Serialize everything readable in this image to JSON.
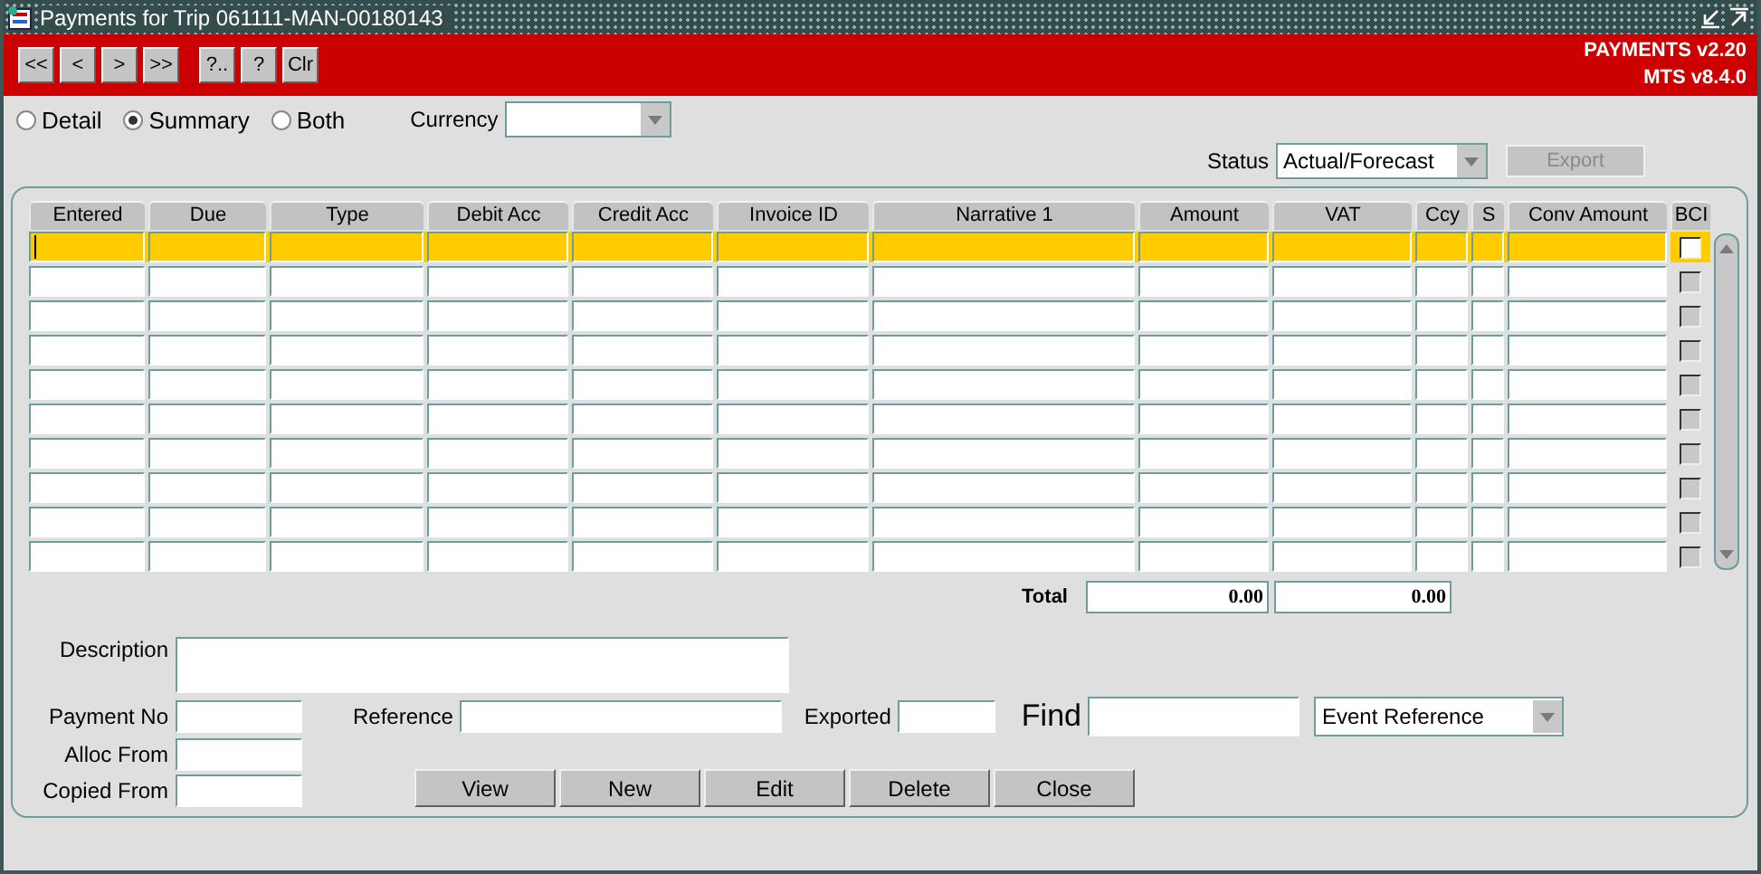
{
  "window": {
    "title": "Payments for Trip 061111-MAN-00180143"
  },
  "toolbar": {
    "button_groups": [
      [
        "<<",
        "<",
        ">",
        ">>"
      ],
      [
        "?..",
        "?",
        "Clr"
      ]
    ],
    "version_lines": [
      "PAYMENTS v2.20",
      "MTS v8.4.0"
    ]
  },
  "view_options": [
    {
      "label": "Detail",
      "selected": false
    },
    {
      "label": "Summary",
      "selected": true
    },
    {
      "label": "Both",
      "selected": false
    }
  ],
  "currency": {
    "label": "Currency"
  },
  "status": {
    "label": "Status",
    "value": "Actual/Forecast"
  },
  "export_button": {
    "label": "Export",
    "disabled": true
  },
  "table": {
    "columns": [
      "Entered",
      "Due",
      "Type",
      "Debit Acc",
      "Credit Acc",
      "Invoice ID",
      "Narrative 1",
      "Amount",
      "VAT",
      "Ccy",
      "S",
      "Conv Amount",
      "BCI"
    ],
    "rows": [
      {
        "selected": true,
        "bci_checked": false
      },
      {
        "selected": false,
        "bci_checked": false
      },
      {
        "selected": false,
        "bci_checked": false
      },
      {
        "selected": false,
        "bci_checked": false
      },
      {
        "selected": false,
        "bci_checked": false
      },
      {
        "selected": false,
        "bci_checked": false
      },
      {
        "selected": false,
        "bci_checked": false
      },
      {
        "selected": false,
        "bci_checked": false
      },
      {
        "selected": false,
        "bci_checked": false
      },
      {
        "selected": false,
        "bci_checked": false
      }
    ]
  },
  "totals": {
    "label": "Total",
    "amount": "0.00",
    "vat": "0.00"
  },
  "form": {
    "description_label": "Description",
    "payment_no_label": "Payment No",
    "reference_label": "Reference",
    "exported_label": "Exported",
    "find_label": "Find",
    "find_by": "Event Reference",
    "alloc_from_label": "Alloc From",
    "copied_from_label": "Copied From"
  },
  "action_buttons": [
    "View",
    "New",
    "Edit",
    "Delete",
    "Close"
  ]
}
